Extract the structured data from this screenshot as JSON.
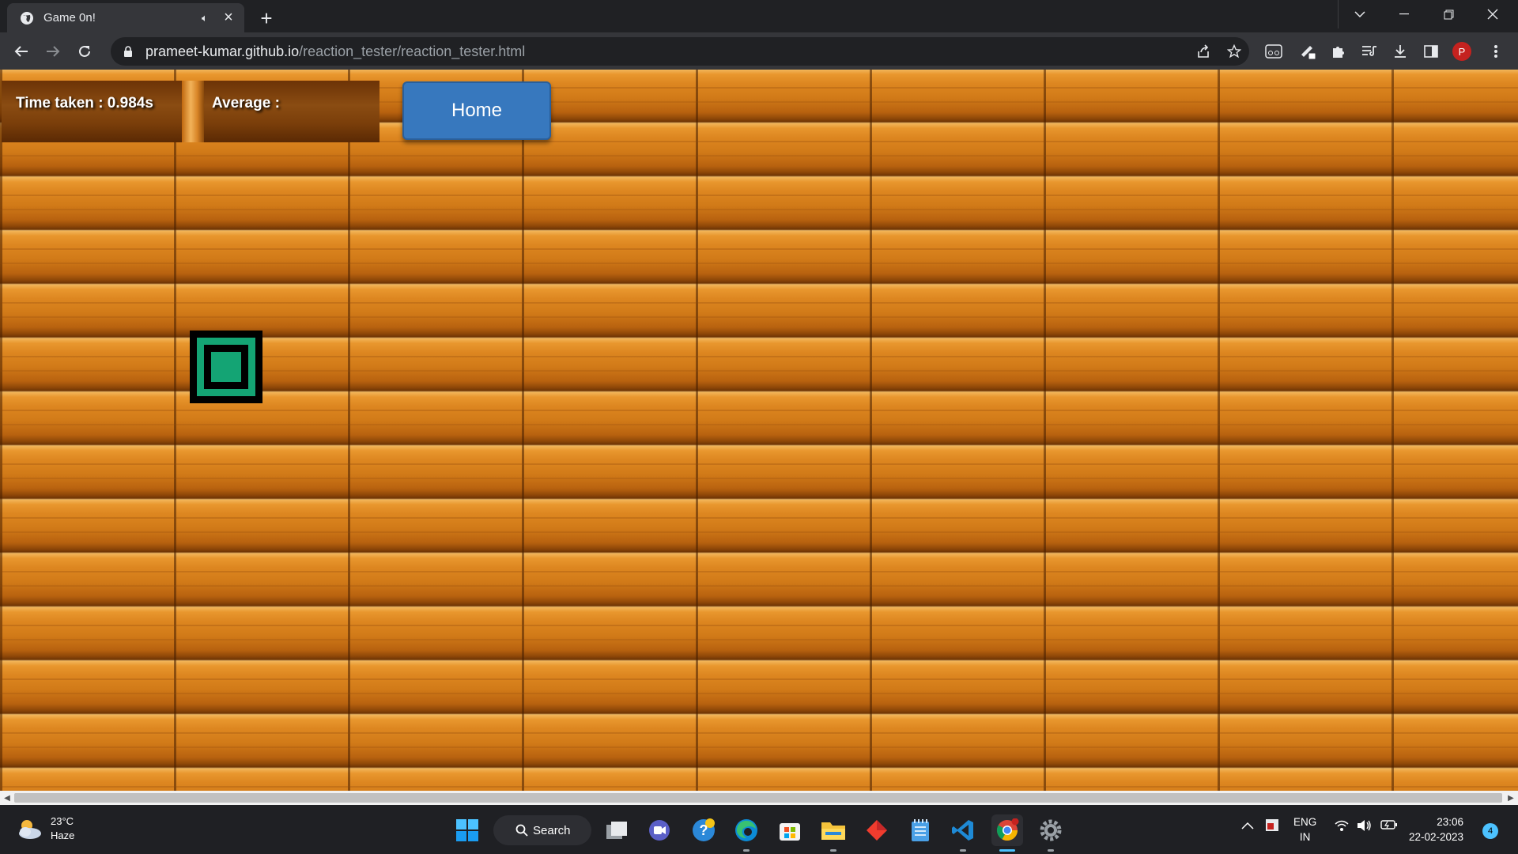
{
  "browser": {
    "tab_title": "Game 0n!",
    "url_host": "prameet-kumar.github.io",
    "url_path": "/reaction_tester/reaction_tester.html",
    "profile_initial": "P"
  },
  "game": {
    "time_taken_label": "Time taken : 0.984s",
    "average_label": "Average :",
    "home_button": "Home",
    "target_color": "#14a474"
  },
  "taskbar": {
    "temperature": "23°C",
    "weather": "Haze",
    "search_label": "Search",
    "lang_top": "ENG",
    "lang_bottom": "IN",
    "time": "23:06",
    "date": "22-02-2023",
    "notification_count": "4",
    "apps": [
      "start-icon",
      "search-icon",
      "task-view-icon",
      "meet-icon",
      "help-icon",
      "edge-icon",
      "store-icon",
      "file-explorer-icon",
      "git-icon",
      "notepad-icon",
      "vscode-icon",
      "chrome-icon",
      "settings-icon"
    ]
  }
}
